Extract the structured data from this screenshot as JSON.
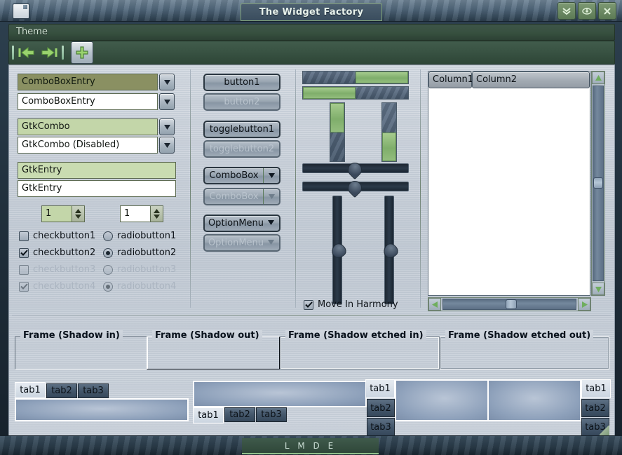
{
  "window": {
    "title": "The Widget Factory",
    "icon": "document-icon",
    "buttons": [
      {
        "name": "minimize-button",
        "glyph": "chevrons-down-icon"
      },
      {
        "name": "maximize-button",
        "glyph": "circle-arrow-icon"
      },
      {
        "name": "close-button",
        "glyph": "close-x-icon"
      }
    ]
  },
  "menubar": {
    "items": [
      {
        "label": "Theme"
      }
    ]
  },
  "toolbar": {
    "items": [
      {
        "name": "separator-1",
        "type": "separator"
      },
      {
        "name": "back-button",
        "type": "arrow",
        "glyph": "arrow-left-icon"
      },
      {
        "name": "forward-button",
        "type": "arrow",
        "glyph": "arrow-right-icon"
      },
      {
        "name": "separator-2",
        "type": "separator"
      },
      {
        "name": "add-button",
        "type": "button",
        "glyph": "plus-icon"
      }
    ]
  },
  "entries": {
    "combo_box_entry_selected": {
      "value": "ComboBoxEntry"
    },
    "combo_box_entry_normal": {
      "value": "ComboBoxEntry"
    },
    "gtk_combo": {
      "value": "GtkCombo"
    },
    "gtk_combo_disabled": {
      "value": "GtkCombo (Disabled)"
    },
    "gtk_entry_selected": {
      "value": "GtkEntry"
    },
    "gtk_entry_normal": {
      "value": "GtkEntry"
    }
  },
  "spinners": {
    "spin_left": {
      "value": "1"
    },
    "spin_right": {
      "value": "1"
    }
  },
  "checkbuttons": [
    {
      "label": "checkbutton1",
      "checked": false,
      "disabled": false
    },
    {
      "label": "checkbutton2",
      "checked": true,
      "disabled": false
    },
    {
      "label": "checkbutton3",
      "checked": false,
      "disabled": true
    },
    {
      "label": "checkbutton4",
      "checked": true,
      "disabled": true
    }
  ],
  "radiobuttons": [
    {
      "label": "radiobutton1",
      "checked": false,
      "disabled": false
    },
    {
      "label": "radiobutton2",
      "checked": true,
      "disabled": false
    },
    {
      "label": "radiobutton3",
      "checked": false,
      "disabled": true
    },
    {
      "label": "radiobutton4",
      "checked": true,
      "disabled": true
    }
  ],
  "buttons": {
    "button1": "button1",
    "button2": "button2",
    "togglebutton1": "togglebutton1",
    "togglebutton2": "togglebutton2",
    "combobox1": "ComboBox",
    "combobox2": "ComboBox",
    "optionmenu1": "OptionMenu",
    "optionmenu2": "OptionMenu"
  },
  "progress": {
    "hbar1_percent": 50,
    "hbar2_percent": 50,
    "vbar1_percent": 50,
    "vbar2_percent": 50
  },
  "scales": {
    "hscale1_percent": 50,
    "hscale2_percent": 50,
    "vscale1_percent": 50,
    "vscale2_percent": 50
  },
  "harmony": {
    "label": "Move In Harmony",
    "checked": true
  },
  "treeview": {
    "columns": [
      "Column1",
      "Column2"
    ],
    "rows": []
  },
  "frames": [
    {
      "label": "Frame (Shadow in)"
    },
    {
      "label": "Frame (Shadow out)"
    },
    {
      "label": "Frame (Shadow etched in)"
    },
    {
      "label": "Frame (Shadow etched out)"
    }
  ],
  "notebooks": [
    {
      "name": "notebook-top",
      "position": "top",
      "tabs": [
        "tab1",
        "tab2",
        "tab3"
      ],
      "active": 0
    },
    {
      "name": "notebook-bottom",
      "position": "bottom",
      "tabs": [
        "tab1",
        "tab2",
        "tab3"
      ],
      "active": 0
    },
    {
      "name": "notebook-left",
      "position": "left",
      "tabs": [
        "tab1",
        "tab2",
        "tab3"
      ],
      "active": 0
    },
    {
      "name": "notebook-right",
      "position": "right",
      "tabs": [
        "tab1",
        "tab2",
        "tab3"
      ],
      "active": 0
    }
  ],
  "statusbar": {
    "text": "L M D E"
  },
  "colors": {
    "accent_green": "#8fc08a",
    "progress_fill": "#7fae6b",
    "selected_entry": "#8a9062",
    "entry_green": "#c3d6a9",
    "titlebar": "#51687c"
  }
}
